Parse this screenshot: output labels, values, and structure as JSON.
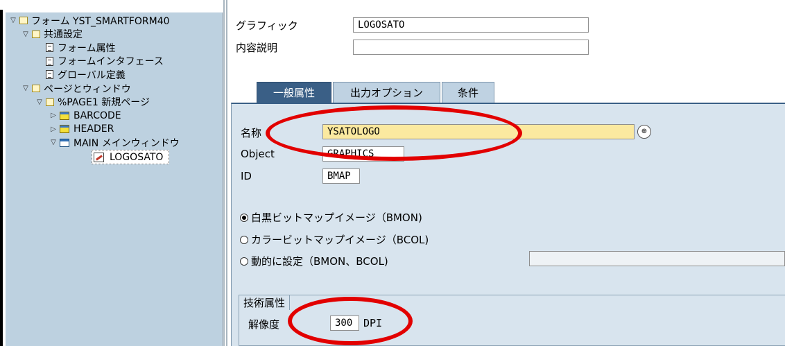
{
  "tree": [
    {
      "label": "フォーム YST_SMARTFORM40",
      "toggle": "▽",
      "icon": "folder-icon",
      "indent": 0
    },
    {
      "label": "共通設定",
      "toggle": "▽",
      "icon": "folder-icon",
      "indent": 1
    },
    {
      "label": "フォーム属性",
      "toggle": "",
      "icon": "document-icon",
      "indent": 2
    },
    {
      "label": "フォームインタフェース",
      "toggle": "",
      "icon": "document-icon",
      "indent": 2
    },
    {
      "label": "グローバル定義",
      "toggle": "",
      "icon": "document-icon",
      "indent": 2
    },
    {
      "label": "ページとウィンドウ",
      "toggle": "▽",
      "icon": "folder-icon",
      "indent": 1
    },
    {
      "label": "%PAGE1 新規ページ",
      "toggle": "▽",
      "icon": "folder-icon",
      "indent": 2
    },
    {
      "label": "BARCODE",
      "toggle": "▷",
      "icon": "window-icon-yellow",
      "indent": 3
    },
    {
      "label": "HEADER",
      "toggle": "▷",
      "icon": "window-icon-yellow",
      "indent": 3
    },
    {
      "label": "MAIN メインウィンドウ",
      "toggle": "▽",
      "icon": "window-icon",
      "indent": 3
    },
    {
      "label": "LOGOSATO",
      "toggle": "",
      "icon": "graphic-icon",
      "indent": 4,
      "selected": true
    }
  ],
  "header": {
    "graphic_label": "グラフィック",
    "graphic_value": "LOGOSATO",
    "description_label": "内容説明",
    "description_value": ""
  },
  "tabs": [
    "一般属性",
    "出力オプション",
    "条件"
  ],
  "general": {
    "name_label": "名称",
    "name_value": "YSATOLOGO",
    "object_label": "Object",
    "object_value": "GRAPHICS",
    "id_label": "ID",
    "id_value": "BMAP"
  },
  "radios": [
    {
      "label": "白黒ビットマップイメージ（BMON)",
      "selected": true
    },
    {
      "label": "カラービットマップイメージ（BCOL)",
      "selected": false
    },
    {
      "label": "動的に設定（BMON、BCOL)",
      "selected": false
    }
  ],
  "tech": {
    "title": "技術属性",
    "resolution_label": "解像度",
    "resolution_value": "300",
    "resolution_unit": "DPI"
  },
  "colors": {
    "tree_bg": "#bdd1e0",
    "panel_bg": "#d8e4ee",
    "active_tab": "#3a5f86",
    "name_field": "#fbe9a0",
    "annotation": "#e20000"
  }
}
